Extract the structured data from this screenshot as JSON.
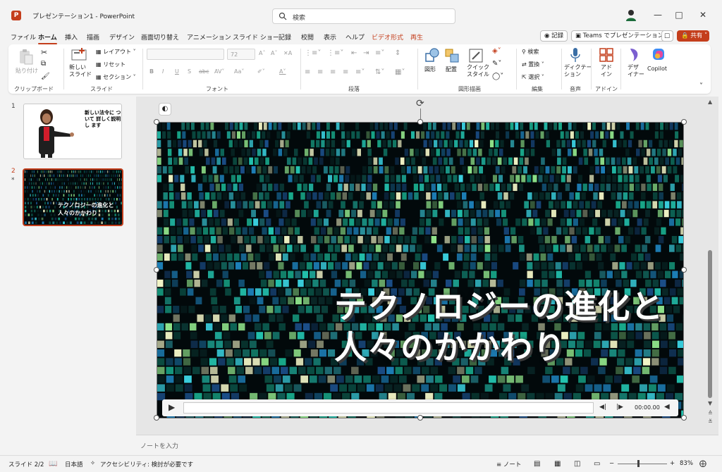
{
  "app": {
    "doc_title": "プレゼンテーション1  -  PowerPoint",
    "search_placeholder": "検索",
    "logo_letter": "P"
  },
  "tabs": [
    {
      "label": "ファイル"
    },
    {
      "label": "ホーム"
    },
    {
      "label": "挿入"
    },
    {
      "label": "描画"
    },
    {
      "label": "デザイン"
    },
    {
      "label": "画面切り替え"
    },
    {
      "label": "アニメーション"
    },
    {
      "label": "スライド ショー"
    },
    {
      "label": "記録"
    },
    {
      "label": "校閲"
    },
    {
      "label": "表示"
    },
    {
      "label": "ヘルプ"
    },
    {
      "label": "ビデオ形式"
    },
    {
      "label": "再生"
    }
  ],
  "top_actions": {
    "record": "記録",
    "teams": "Teams でプレゼンテーション",
    "share": "共有"
  },
  "ribbon": {
    "paste": "貼り付け",
    "clipboard_group": "クリップボード",
    "new_slide": "新しい\nスライド",
    "layout": "レイアウト",
    "reset": "リセット",
    "section": "セクション",
    "slides_group": "スライド",
    "font_size": "72",
    "font_group": "フォント",
    "paragraph_group": "段落",
    "shape": "図形",
    "arrange": "配置",
    "quick_style": "クイック\nスタイル",
    "drawing_group": "図形描画",
    "find": "検索",
    "replace": "置換",
    "select": "選択",
    "editing_group": "編集",
    "dictate": "ディクテー\nション",
    "voice_group": "音声",
    "addins": "アド\nイン",
    "addins_group": "アドイン",
    "designer": "デザ\nイナー",
    "copilot": "Copilot"
  },
  "thumbnails": [
    {
      "num": "1",
      "text": "新しい法令に ついて 詳しく説明し ます"
    },
    {
      "num": "2",
      "marker": "*",
      "text": "テクノロジーの進化と人々のかかわり"
    }
  ],
  "slide": {
    "title_line1": "テクノロジーの進化と",
    "title_line2": "人々のかかわり",
    "media_time": "00:00.00"
  },
  "notes_placeholder": "ノートを入力",
  "status": {
    "slide_pos": "スライド 2/2",
    "language": "日本語",
    "accessibility": "アクセシビリティ: 検討が必要です",
    "notes": "ノート",
    "zoom": "83%"
  },
  "colors": {
    "accent": "#c43e1c"
  }
}
